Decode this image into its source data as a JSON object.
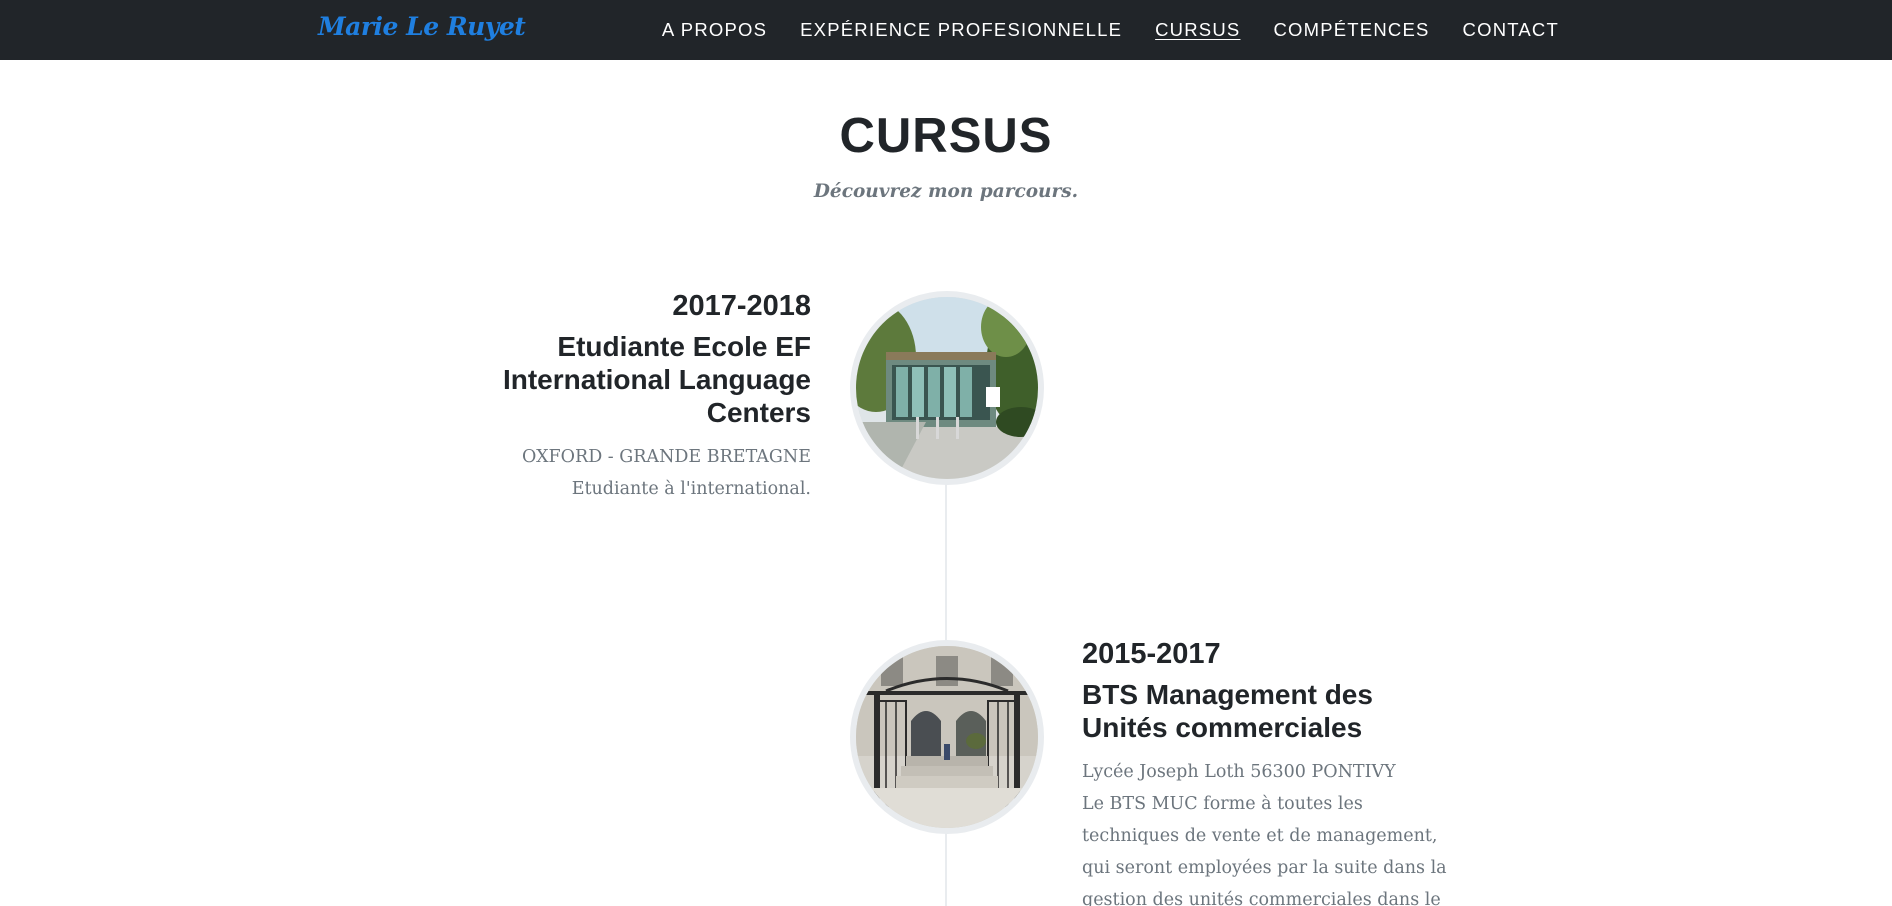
{
  "navbar": {
    "brand": "Marie Le Ruyet",
    "items": [
      {
        "label": "A PROPOS",
        "active": false
      },
      {
        "label": "EXPÉRIENCE PROFESIONNELLE",
        "active": false
      },
      {
        "label": "CURSUS",
        "active": true
      },
      {
        "label": "COMPÉTENCES",
        "active": false
      },
      {
        "label": "CONTACT",
        "active": false
      }
    ]
  },
  "section": {
    "heading": "CURSUS",
    "subheading": "Découvrez mon parcours."
  },
  "timeline": [
    {
      "year": "2017-2018",
      "title": "Etudiante Ecole EF International Language Centers",
      "location": "OXFORD - GRANDE BRETAGNE",
      "description": "Etudiante à l'international."
    },
    {
      "year": "2015-2017",
      "title": "BTS Management des Unités commerciales",
      "location": "Lycée Joseph Loth 56300 PONTIVY",
      "description": "Le BTS MUC forme à toutes les techniques de vente et de management, qui seront employées par la suite dans la gestion des unités commerciales dans le but de"
    }
  ],
  "colors": {
    "navbar_bg": "#212529",
    "brand": "#1f7fe0",
    "muted": "#6c757d",
    "timeline_line": "#e9ecef"
  }
}
